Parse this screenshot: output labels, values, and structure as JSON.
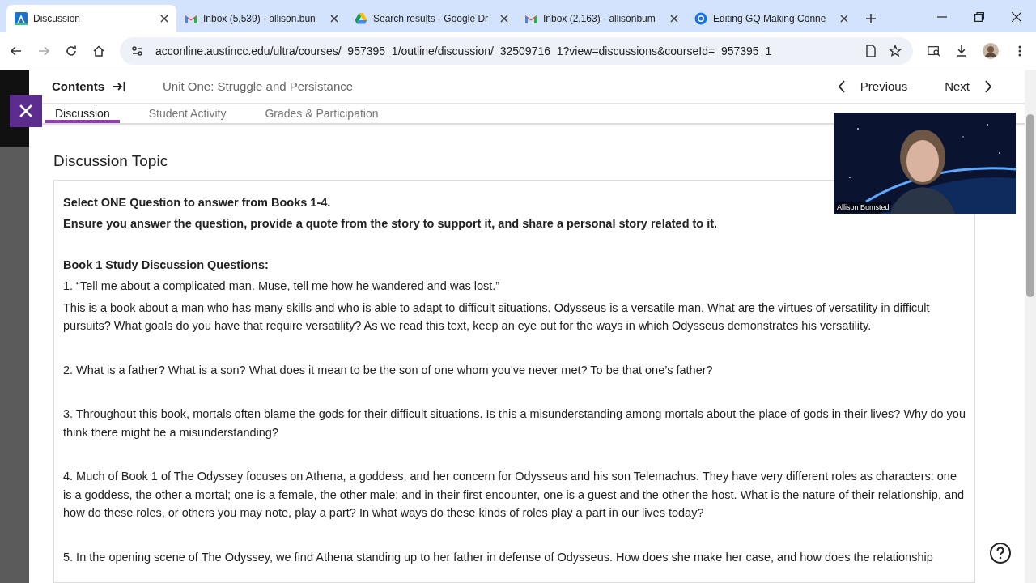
{
  "browser": {
    "tabs": [
      {
        "title": "Discussion",
        "selected": true
      },
      {
        "title": "Inbox (5,539) - allison.bun",
        "selected": false
      },
      {
        "title": "Search results - Google Dr",
        "selected": false
      },
      {
        "title": "Inbox (2,163) - allisonbum",
        "selected": false
      },
      {
        "title": "Editing GQ Making Conne",
        "selected": false
      }
    ],
    "address": "acconline.austincc.edu/ultra/courses/_957395_1/outline/discussion/_32509716_1?view=discussions&courseId=_957395_1"
  },
  "header": {
    "contents": "Contents",
    "unit_title": "Unit One: Struggle and Persistance",
    "previous": "Previous",
    "next": "Next"
  },
  "subtabs": [
    {
      "label": "Discussion",
      "selected": true
    },
    {
      "label": "Student Activity",
      "selected": false
    },
    {
      "label": "Grades & Participation",
      "selected": false
    }
  ],
  "video": {
    "caption": "Allison Bumsted"
  },
  "topic": {
    "title": "Discussion Topic",
    "paragraphs": [
      {
        "kind": "instruction",
        "text": "Select ONE Question to answer from Books 1-4."
      },
      {
        "kind": "instruction",
        "text": "Ensure you answer the question, provide a quote from the story to support it, and share a personal story related to it."
      },
      {
        "kind": "heading",
        "text": "Book 1 Study Discussion Questions:"
      },
      {
        "kind": "quote",
        "text": "1. “Tell me about a complicated man. Muse, tell me how he wandered and was lost.”"
      },
      {
        "kind": "body",
        "text": "This is a book about a man who has many skills and who is able to adapt to difficult situations. Odysseus is a versatile man. What are the virtues of versatility in difficult pursuits? What goals do you have that require versatility? As we read this text, keep an eye out for the ways in which Odysseus demonstrates his versatility."
      },
      {
        "kind": "question",
        "text": "2. What is a father? What is a son? What does it mean to be the son of one whom you've never met? To be that one’s father?"
      },
      {
        "kind": "question",
        "text": "3. Throughout this book, mortals often blame the gods for their difficult situations. Is this a misunderstanding among mortals about the place of gods in their lives? Why do you think there might be a misunderstanding?"
      },
      {
        "kind": "question",
        "text": "4. Much of Book 1 of The Odyssey focuses on Athena, a goddess, and her concern for Odysseus and his son Telemachus. They have very different roles as characters: one is a goddess, the other a mortal; one is a female, the other male; and in their first encounter, one is a guest and the other the host. What is the nature of their relationship, and how do these roles, or others you may note, play a part? In what ways do these kinds of roles play a part in our lives today?"
      },
      {
        "kind": "question",
        "text": "5. In the opening scene of The Odyssey, we find Athena standing up to her father in defense of Odysseus. How does she make her case, and how does the relationship"
      }
    ]
  }
}
